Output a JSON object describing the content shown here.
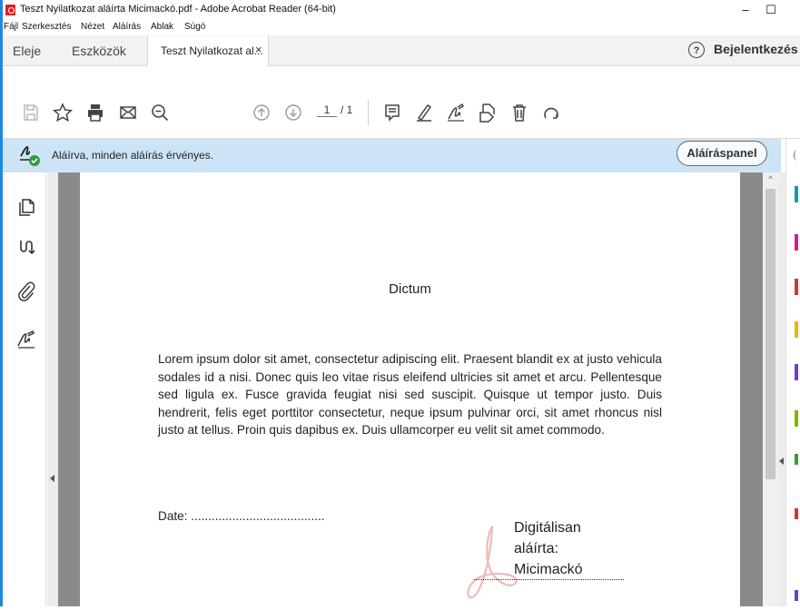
{
  "window": {
    "title": "Teszt Nyilatkozat aláírta Micimackó.pdf - Adobe Acrobat Reader (64-bit)",
    "minimize_glyph": "–",
    "maximize_glyph": "☐"
  },
  "menu": [
    "Fájl",
    "Szerkesztés",
    "Nézet",
    "Aláírás",
    "Ablak",
    "Súgó"
  ],
  "tabs": {
    "home": "Eleje",
    "tools": "Eszközök",
    "document": "Teszt Nyilatkozat al...",
    "close_glyph": "×",
    "help_glyph": "?",
    "sign_in": "Bejelentkezés"
  },
  "toolbar": {
    "page_current": "1",
    "page_total": "/ 1",
    "icons": [
      "save-icon",
      "star-icon",
      "print-icon",
      "email-icon",
      "zoom-search-icon",
      "page-up-icon",
      "page-down-icon",
      "comment-icon",
      "highlight-pen-icon",
      "sign-icon",
      "stamp-icon",
      "delete-icon",
      "rotate-icon"
    ]
  },
  "signature_bar": {
    "status": "Aláírva, minden aláírás érvényes.",
    "panel_button": "Aláíráspanel",
    "status_color": "#cde4f7"
  },
  "sidebar": {
    "icons": [
      "pages-icon",
      "bookmark-fork-icon",
      "attachment-icon",
      "signature-icon"
    ]
  },
  "document": {
    "title": "Dictum",
    "body": "Lorem ipsum dolor sit amet, consectetur adipiscing elit. Praesent blandit ex at justo vehicula sodales id a nisi. Donec quis leo vitae risus eleifend ultricies sit amet et arcu. Pellentesque sed ligula ex. Fusce gravida feugiat nisi sed suscipit. Quisque ut tempor justo. Duis hendrerit, felis eget porttitor consectetur, neque ipsum pulvinar orci, sit amet rhoncus nisl justo at tellus. Proin quis dapibus ex. Duis ullamcorper eu velit sit amet commodo.",
    "date_label": "Date: .......................................",
    "stamp_line1": "Digitálisan",
    "stamp_line2": "aláírta:",
    "stamp_line3": "Micimackó"
  },
  "scrollbar": {
    "up_glyph": "^"
  },
  "colors": {
    "accent": "#1e88e5",
    "acrobat_red": "#e0201f",
    "valid_green": "#2e9e3a"
  }
}
